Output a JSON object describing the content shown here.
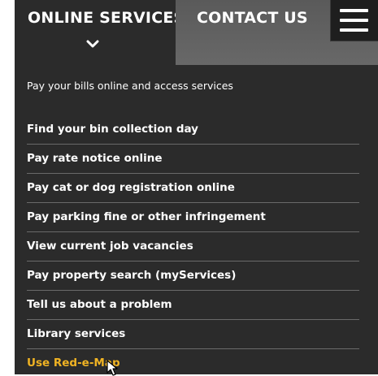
{
  "tabs": {
    "online": {
      "label": "ONLINE SERVICES",
      "icon": "chevron-down-icon"
    },
    "contact": {
      "label": "CONTACT US"
    },
    "menu_icon": "hamburger-menu-icon"
  },
  "intro": "Pay your bills online and access services",
  "links": [
    {
      "label": "Find your bin collection day"
    },
    {
      "label": "Pay rate notice online"
    },
    {
      "label": "Pay cat or dog registration online"
    },
    {
      "label": "Pay parking fine or other infringement"
    },
    {
      "label": "View current job vacancies"
    },
    {
      "label": "Pay property search (myServices)"
    },
    {
      "label": "Tell us about a problem"
    },
    {
      "label": "Library services"
    },
    {
      "label": "Use Red-e-Map"
    }
  ],
  "colors": {
    "panel": "#2b2b2b",
    "contact_tab": "#636363",
    "menu_button": "#1e1e1e",
    "link_text": "#ffffff",
    "active_link": "#f0b323",
    "divider": "#6a6a6a"
  }
}
